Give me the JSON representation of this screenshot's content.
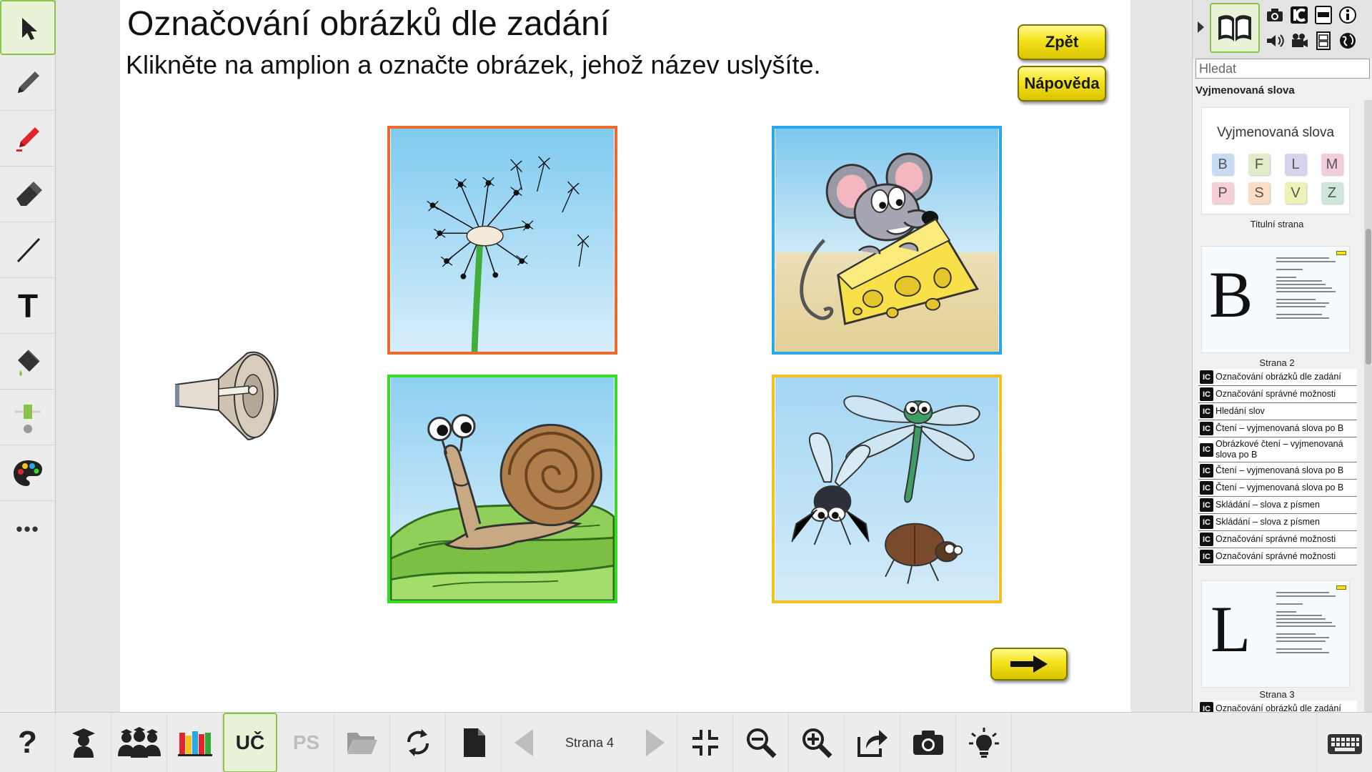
{
  "page": {
    "title": "Označování obrázků dle zadání",
    "instruction": "Klikněte na amplion a označte obrázek, jehož název uslyšíte."
  },
  "buttons": {
    "back": "Zpět",
    "help": "Nápověda"
  },
  "images": [
    {
      "name": "dandelion",
      "border": "#ee6a2a"
    },
    {
      "name": "mouse-cheese",
      "border": "#28a8e8"
    },
    {
      "name": "snail",
      "border": "#33dd22"
    },
    {
      "name": "insects",
      "border": "#f3c11b"
    }
  ],
  "left_tools": [
    "select-arrow-icon",
    "pencil-icon",
    "marker-icon",
    "eraser-icon",
    "line-icon",
    "text-tool-icon",
    "fill-bucket-icon",
    "line-width-icon",
    "palette-icon",
    "more-icon"
  ],
  "left_tool_text": {
    "text_tool": "T",
    "more": "•••"
  },
  "right_panel": {
    "search_placeholder": "Hledat",
    "section_title": "Vyjmenovaná slova",
    "cover": {
      "heading": "Vyjmenovaná slova",
      "letters": [
        "B",
        "F",
        "L",
        "M",
        "P",
        "S",
        "V",
        "Z"
      ],
      "letter_colors": [
        "#c6dcf5",
        "#e2ecc8",
        "#d9d2ef",
        "#f3cddd",
        "#f6cfd6",
        "#fbdcc5",
        "#eef2b8",
        "#cde7d9"
      ],
      "caption": "Titulní strana"
    },
    "page_b": {
      "letter": "B",
      "caption": "Strana 2",
      "items": [
        "Označování obrázků dle zadání",
        "Označování správné možnosti",
        "Hledání slov",
        "Čtení – vyjmenovaná slova po B",
        "Obrázkové čtení – vyjmenovaná slova po B",
        "Čtení – vyjmenovaná slova po B",
        "Čtení – vyjmenovaná slova po B",
        "Skládání – slova z písmen",
        "Skládání – slova z písmen",
        "Označování správné možnosti",
        "Označování správné možnosti"
      ]
    },
    "page_l": {
      "letter": "L",
      "caption": "Strana 3",
      "items": [
        "Označování obrázků dle zadání"
      ]
    },
    "item_icon": "IC"
  },
  "bottom_bar": {
    "help": "?",
    "uc": "UČ",
    "ps": "PS",
    "page_label": "Strana 4"
  }
}
